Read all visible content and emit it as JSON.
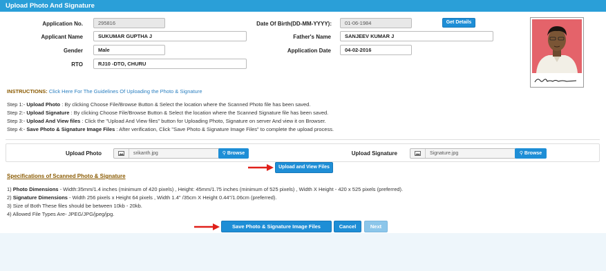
{
  "header": {
    "title": "Upload Photo And Signature"
  },
  "form": {
    "application_no": {
      "label": "Application No.",
      "value": "295816"
    },
    "dob": {
      "label": "Date Of Birth(DD-MM-YYYY):",
      "value": "01-06-1984"
    },
    "get_details": "Get Details",
    "applicant_name": {
      "label": "Applicant Name",
      "value": "SUKUMAR GUPTHA J"
    },
    "father_name": {
      "label": "Father's Name",
      "value": "SANJEEV KUMAR J"
    },
    "gender": {
      "label": "Gender",
      "value": "Male"
    },
    "application_date": {
      "label": "Application Date",
      "value": "04-02-2016"
    },
    "rto": {
      "label": "RTO",
      "value": "RJ10 -DTO, CHURU"
    }
  },
  "photo": {
    "signature_text": "Sukumar"
  },
  "instructions": {
    "heading": "INSTRUCTIONS:",
    "link": "Click Here For The Guidelines Of Uploading the Photo & Signature",
    "steps": [
      {
        "prefix": "Step 1:- ",
        "bold": "Upload Photo",
        "text": " : By clicking Choose File/Browse Button & Select the location where the Scanned Photo file has been saved."
      },
      {
        "prefix": "Step 2:- ",
        "bold": "Upload Signature",
        "text": " : By clicking Choose File/Browse Button & Select the location where the Scanned Signature file has been saved."
      },
      {
        "prefix": "Step 3:- ",
        "bold": "Upload And View files",
        "text": " : Click the \"Upload And View files\" button for Uploading Photo, Signature on server And view it on Browser."
      },
      {
        "prefix": "Step 4:- ",
        "bold": "Save Photo & Signature Image Files",
        "text": " : After verification, Click \"Save Photo & Signature Image Files\" to complete the upload process."
      }
    ]
  },
  "upload": {
    "photo_label": "Upload Photo",
    "photo_file": "srikanth.jpg",
    "signature_label": "Upload Signature",
    "signature_file": "Signature.jpg",
    "browse": "Browse",
    "upload_view": "Upload and View Files"
  },
  "specs": {
    "title": "Specifications of Scanned Photo & Signature",
    "items": [
      {
        "prefix": "1) ",
        "bold": "Photo Dimensions",
        "text": " - Width:35mm/1.4 inches (minimum of 420 pixels) , Height: 45mm/1.75 inches (minimum of 525 pixels) , Width X Height - 420 x 525 pixels (preferred)."
      },
      {
        "prefix": "2) ",
        "bold": "Signature Dimensions",
        "text": " - Width 256 pixels x Height 64 pixels , Width 1.4\" /35cm X Height 0.44\"/1.06cm (preferred)."
      },
      {
        "prefix": "3) ",
        "bold": "",
        "text": "Size of Both These files should be between 10kb - 20kb."
      },
      {
        "prefix": "4) ",
        "bold": "",
        "text": "Allowed File Types Are- JPEG/JPG/jpeg/jpg."
      }
    ]
  },
  "actions": {
    "save": "Save Photo & Signature Image Files",
    "cancel": "Cancel",
    "next": "Next"
  },
  "colors": {
    "header": "#2a9fd8",
    "button": "#1e8ed6",
    "arrow": "#e0201a"
  }
}
